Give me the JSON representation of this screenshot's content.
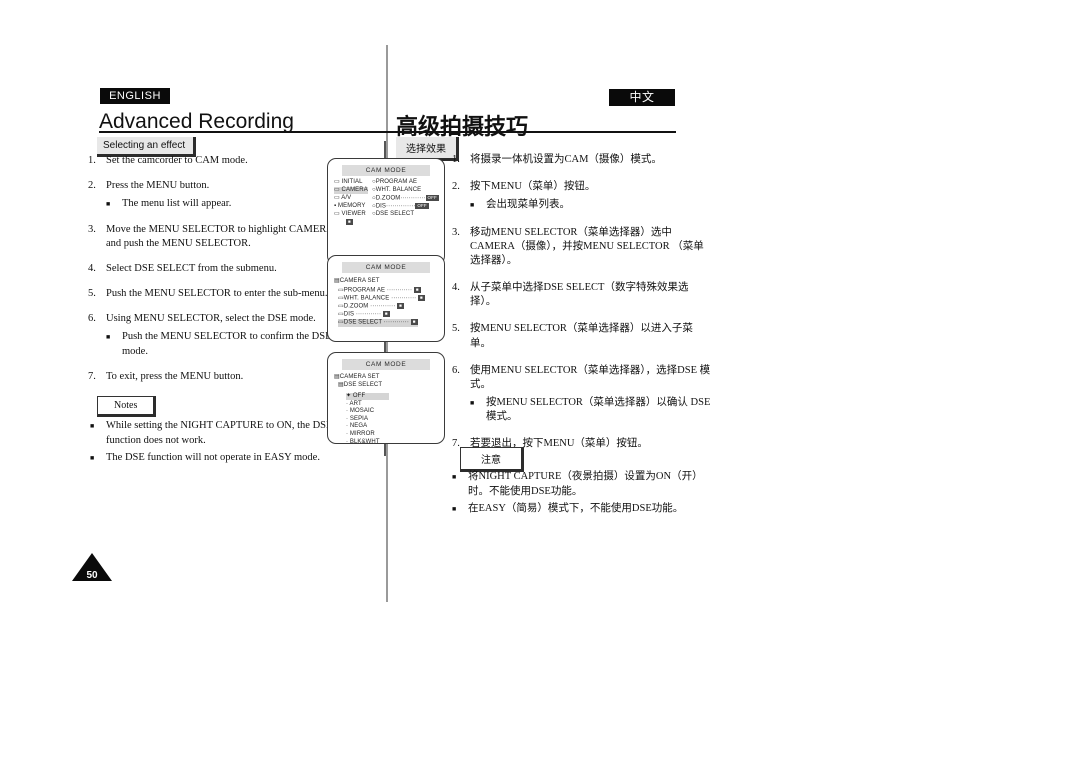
{
  "header": {
    "lang_en": "ENGLISH",
    "lang_zh": "中文",
    "title_en": "Advanced Recording",
    "title_zh": "高级拍摄技巧",
    "subhead_en": "Selecting an effect",
    "subhead_zh": "选择效果"
  },
  "steps_en": [
    {
      "num": "1.",
      "text": "Set the camcorder to CAM mode.",
      "sub": []
    },
    {
      "num": "2.",
      "text": "Press the MENU button.",
      "sub": [
        "The menu list will appear."
      ]
    },
    {
      "num": "3.",
      "text": "Move the MENU SELECTOR to highlight CAMERA and push the MENU SELECTOR.",
      "sub": []
    },
    {
      "num": "4.",
      "text": "Select DSE SELECT from the submenu.",
      "sub": []
    },
    {
      "num": "5.",
      "text": "Push the MENU SELECTOR to enter the sub-menu.",
      "sub": []
    },
    {
      "num": "6.",
      "text": "Using MENU SELECTOR, select the DSE mode.",
      "sub": [
        "Push the MENU SELECTOR to confirm the DSE mode."
      ]
    },
    {
      "num": "7.",
      "text": "To exit, press the MENU button.",
      "sub": []
    }
  ],
  "steps_zh": [
    {
      "num": "1.",
      "text": "将摄录一体机设置为CAM（摄像）模式。",
      "sub": []
    },
    {
      "num": "2.",
      "text": "按下MENU（菜单）按钮。",
      "sub": [
        "会出现菜单列表。"
      ]
    },
    {
      "num": "3.",
      "text": "移动MENU SELECTOR（菜单选择器）选中 CAMERA（摄像），并按MENU SELECTOR （菜单选择器）。",
      "sub": []
    },
    {
      "num": "4.",
      "text": "从子菜单中选择DSE SELECT（数字特殊效果选择）。",
      "sub": []
    },
    {
      "num": "5.",
      "text": "按MENU SELECTOR（菜单选择器）以进入子菜单。",
      "sub": []
    },
    {
      "num": "6.",
      "text": "使用MENU SELECTOR（菜单选择器），选择DSE 模式。",
      "sub": [
        "按MENU SELECTOR（菜单选择器）以确认 DSE模式。"
      ]
    },
    {
      "num": "7.",
      "text": "若要退出，按下MENU（菜单）按钮。",
      "sub": []
    }
  ],
  "notes_en": {
    "label": "Notes",
    "items": [
      "While setting the NIGHT CAPTURE to ON, the DSE function does not work.",
      "The DSE function will not operate in EASY mode."
    ]
  },
  "notes_zh": {
    "label": "注意",
    "items": [
      "将NIGHT CAPTURE（夜景拍摄）设置为ON（开）时。不能使用DSE功能。",
      "在EASY（简易）模式下，不能使用DSE功能。"
    ]
  },
  "lcd1": {
    "title": "CAM MODE",
    "left_items": [
      "INITIAL",
      "CAMERA",
      "A/V",
      "MEMORY",
      "VIEWER"
    ],
    "right_items": [
      "PROGRAM AE",
      "WHT. BALANCE",
      "D.ZOOM",
      "DIS",
      "DSE SELECT"
    ],
    "highlight": "CAMERA"
  },
  "lcd2": {
    "title": "CAM MODE",
    "heading": "CAMERA SET",
    "items": [
      "PROGRAM AE",
      "WHT. BALANCE",
      "D.ZOOM",
      "DIS",
      "DSE SELECT"
    ],
    "highlight": "DSE SELECT"
  },
  "lcd3": {
    "title": "CAM MODE",
    "heading1": "CAMERA SET",
    "heading2": "DSE SELECT",
    "items": [
      "OFF",
      "ART",
      "MOSAIC",
      "SEPIA",
      "NEGA",
      "MIRROR",
      "BLK&WHT"
    ],
    "highlight": "OFF"
  },
  "footer": {
    "page_number": "50"
  }
}
